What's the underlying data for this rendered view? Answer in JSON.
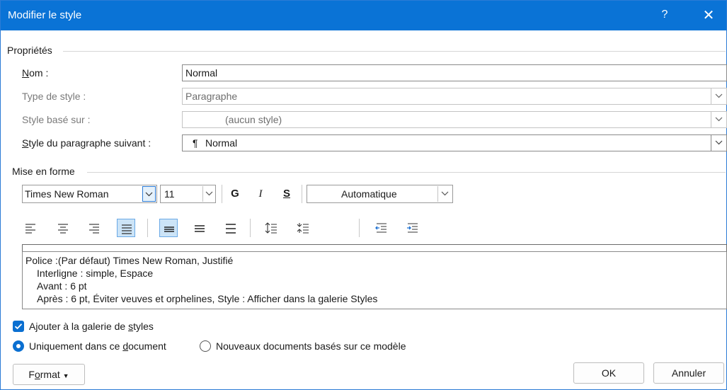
{
  "titlebar": {
    "title": "Modifier le style",
    "help": "?",
    "close": "✕"
  },
  "properties": {
    "section": "Propriétés",
    "name_label": "Nom :",
    "name_value": "Normal",
    "style_type_label": "Type de style :",
    "style_type_value": "Paragraphe",
    "based_on_label": "Style basé sur :",
    "based_on_value": "(aucun style)",
    "next_label": "Style du paragraphe suivant :",
    "next_value": "Normal",
    "next_icon": "¶"
  },
  "formatting": {
    "section": "Mise en forme",
    "font": "Times New Roman",
    "size": "11",
    "bold": "G",
    "italic": "I",
    "underline": "S",
    "color": "Automatique"
  },
  "description": {
    "line1": "Police :(Par défaut) Times New Roman, Justifié",
    "line2": "Interligne : simple, Espace",
    "line3": "Avant : 6 pt",
    "line4": "Après : 6 pt, Éviter veuves et orphelines, Style : Afficher dans la galerie Styles"
  },
  "options": {
    "add_gallery": "Ajouter à la galerie de styles",
    "add_gallery_checked": true,
    "only_doc": "Uniquement dans ce document",
    "new_docs": "Nouveaux documents basés sur ce modèle",
    "selected": "only_doc"
  },
  "buttons": {
    "format": "Format",
    "ok": "OK",
    "cancel": "Annuler"
  },
  "colors": {
    "accent": "#0a73d6",
    "active_bg": "#cce4f7"
  }
}
